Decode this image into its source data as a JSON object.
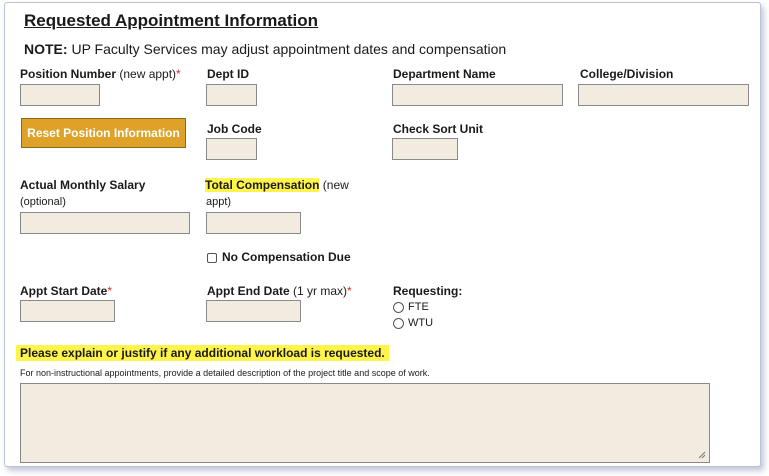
{
  "section": {
    "title": "Requested Appointment Information",
    "note_prefix": "NOTE:",
    "note_text": " UP Faculty Services may adjust appointment dates and compensation"
  },
  "fields": {
    "position_number": {
      "label": "Position Number",
      "hint": " (new appt)",
      "required": "*",
      "value": ""
    },
    "dept_id": {
      "label": "Dept ID",
      "value": ""
    },
    "department_name": {
      "label": "Department Name",
      "value": ""
    },
    "college_division": {
      "label": "College/Division",
      "value": ""
    },
    "job_code": {
      "label": "Job Code",
      "value": ""
    },
    "check_sort_unit": {
      "label": "Check Sort Unit",
      "value": ""
    },
    "actual_monthly_salary": {
      "label": "Actual Monthly Salary",
      "sublabel": "(optional)",
      "value": ""
    },
    "total_compensation": {
      "label": "Total Compensation",
      "hint_a": " (new",
      "hint_b": "appt)",
      "value": ""
    },
    "appt_start_date": {
      "label": "Appt Start Date",
      "required": "*",
      "value": ""
    },
    "appt_end_date": {
      "label": "Appt End Date",
      "hint": " (1 yr max)",
      "required": "*",
      "value": ""
    }
  },
  "buttons": {
    "reset_position": "Reset Position Information"
  },
  "no_compensation": {
    "label": "No Compensation Due",
    "checked": false
  },
  "requesting": {
    "label": "Requesting:",
    "options": [
      "FTE",
      "WTU"
    ],
    "selected": null
  },
  "workload": {
    "heading": "Please explain or justify if any additional workload is requested.",
    "instructions": "For non-instructional appointments, provide a detailed description of the project title and scope of work.",
    "value": ""
  },
  "colors": {
    "highlight": "#fff44a",
    "button": "#dea229",
    "field_bg": "#f2ebdf",
    "required": "#d0302a"
  }
}
